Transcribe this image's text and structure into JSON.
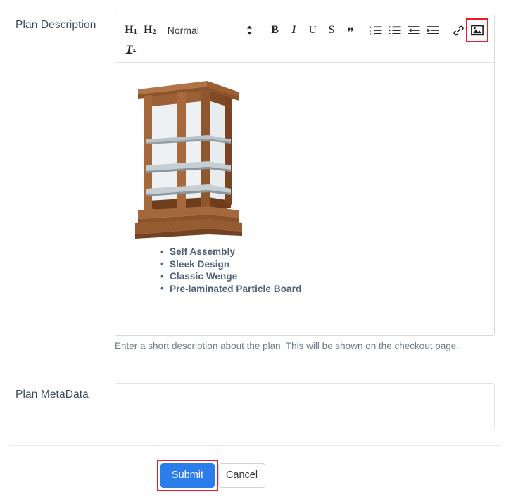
{
  "form": {
    "rows": [
      {
        "label": "Plan Description"
      },
      {
        "label": "Plan MetaData"
      }
    ]
  },
  "editor": {
    "toolbar": {
      "heading1": "H",
      "heading1_sub": "1",
      "heading2": "H",
      "heading2_sub": "2",
      "format_picker_value": "Normal",
      "bold": "B",
      "italic": "I",
      "underline": "U",
      "strikethrough": "S",
      "blockquote": "”",
      "clear_format": "T",
      "clear_format_sub": "x",
      "icons": [
        "ordered-list-icon",
        "bullet-list-icon",
        "outdent-icon",
        "indent-icon",
        "link-icon",
        "image-icon"
      ]
    },
    "content": {
      "image_alt": "wooden display cabinet with glass shelves",
      "features": [
        "Self Assembly",
        "Sleek Design",
        "Classic Wenge",
        "Pre-laminated Particle Board"
      ]
    },
    "help_text": "Enter a short description about the plan. This will be shown on the checkout page."
  },
  "metadata": {
    "value": "",
    "placeholder": ""
  },
  "actions": {
    "submit_label": "Submit",
    "cancel_label": "Cancel"
  },
  "colors": {
    "primary": "#2b7de9",
    "annotation": "#ee1c22",
    "label_text": "#3d4a5c",
    "help_text": "#6e7b8d",
    "feature_text": "#4f6177",
    "wood_light": "#a86a3c",
    "wood_mid": "#95592f",
    "wood_dark": "#7a4423",
    "glass": "#eef1f3"
  }
}
